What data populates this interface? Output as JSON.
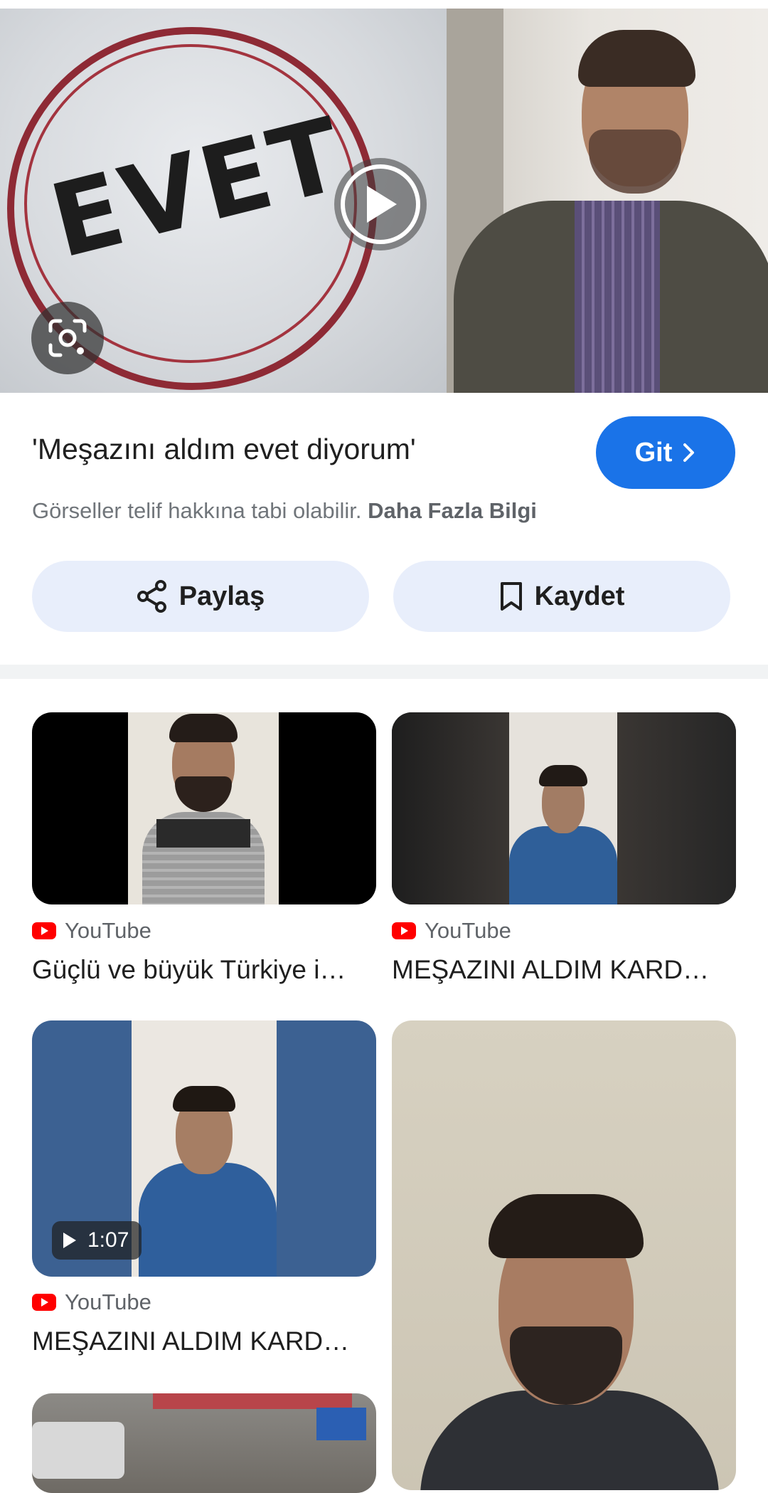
{
  "hero": {
    "stamp_text": "EVET",
    "play_label": "Play video",
    "lens_label": "Search image"
  },
  "result": {
    "title": "'Meşazını aldım evet diyorum'",
    "visit_button": "Git",
    "copyright_text": "Görseller telif hakkına tabi olabilir.",
    "learn_more": "Daha Fazla Bilgi"
  },
  "actions": {
    "share_label": "Paylaş",
    "save_label": "Kaydet"
  },
  "related": [
    {
      "source": "YouTube",
      "caption": "Güçlü ve büyük Türkiye i…"
    },
    {
      "source": "YouTube",
      "caption": "MEŞAZINI ALDIM KARD…"
    },
    {
      "source": "YouTube",
      "caption": "MEŞAZINI ALDIM KARD…",
      "duration": "1:07"
    }
  ],
  "icons": {
    "lens": "google-lens-icon",
    "play": "play-circle-icon",
    "share": "share-icon",
    "save": "bookmark-icon",
    "visit": "chevron-right-icon",
    "source": "youtube-icon"
  },
  "colors": {
    "accent": "#1a73e8",
    "pill_bg": "#e8eefb",
    "youtube_red": "#ff0000"
  }
}
